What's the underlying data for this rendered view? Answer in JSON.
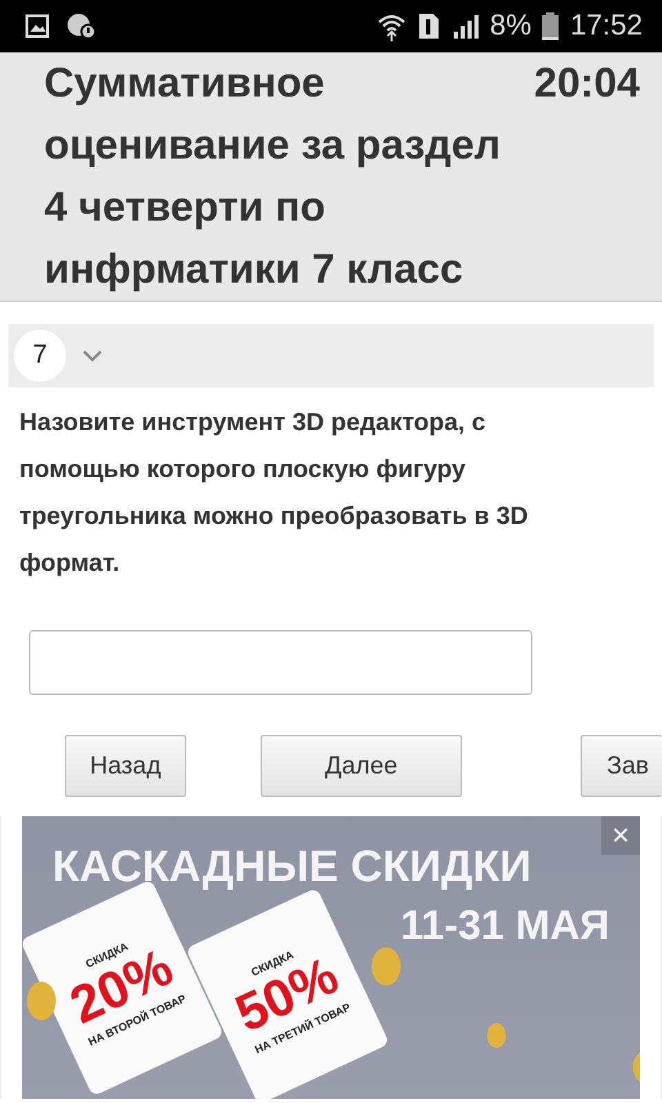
{
  "status_bar": {
    "battery_text": "8%",
    "time": "17:52"
  },
  "header": {
    "title": "Суммативное оценивание за раздел 4 четверти по инфрматики 7 класс",
    "timer": "20:04"
  },
  "question": {
    "number": "7",
    "expanded": false,
    "text": "Назовите инструмент 3D редактора, с помощью которого плоскую фигуру треугольника можно преобразовать в 3D формат."
  },
  "buttons": [
    {
      "label": "Назад",
      "kind": "narrow"
    },
    {
      "label": "Далее",
      "kind": "wide"
    },
    {
      "label": "Зав",
      "kind": "cut"
    }
  ],
  "ad": {
    "title": "КАСКАДНЫЕ СКИДКИ",
    "dates": "11-31 МАЯ",
    "close": "×",
    "cards": [
      {
        "top": "СКИДКА",
        "value": "20%",
        "bottom": "НА ВТОРОЙ ТОВАР"
      },
      {
        "top": "СКИДКА",
        "value": "50%",
        "bottom": "НА ТРЕТИЙ ТОВАР"
      }
    ]
  }
}
